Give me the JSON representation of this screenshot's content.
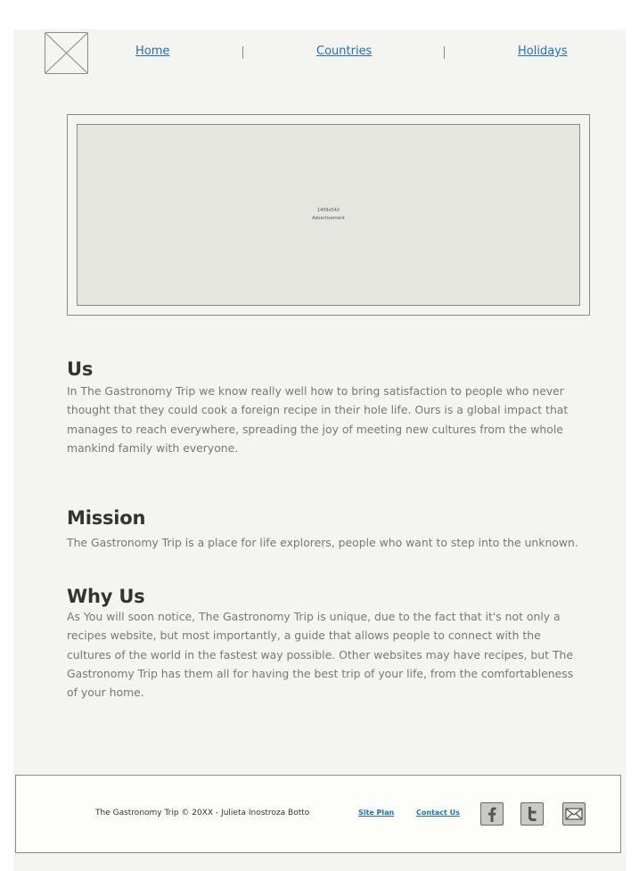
{
  "header": {
    "logo_icon": "image-placeholder-icon",
    "nav": [
      {
        "label": "Home"
      },
      {
        "label": "Countries"
      },
      {
        "label": "Holidays"
      }
    ]
  },
  "ad": {
    "size": "1409x542",
    "label": "Advertisement"
  },
  "sections": [
    {
      "title": "Us",
      "text": "In The Gastronomy Trip we know really well how to bring satisfaction to people who never thought that they could cook a foreign recipe in their hole life. Ours is a global impact that manages to reach everywhere, spreading the joy of meeting new cultures from the whole mankind family with everyone."
    },
    {
      "title": "Mission",
      "text": "The Gastronomy Trip is a place for life explorers, people who want to step into the unknown."
    },
    {
      "title": "Why Us",
      "text": "As You will soon notice, The Gastronomy Trip is unique, due to the fact that it's not only a recipes website, but most importantly, a guide that allows people to connect with the cultures of the world in the fastest way possible. Other websites may have recipes, but The Gastronomy Trip has them all for having the best trip of your life, from the comfortableness of your home."
    }
  ],
  "footer": {
    "copyright": "The Gastronomy Trip © 20XX - Julieta Inostroza Botto",
    "links": [
      {
        "label": "Site Plan"
      },
      {
        "label": "Contact Us"
      }
    ],
    "social": [
      {
        "icon": "facebook-icon"
      },
      {
        "icon": "twitter-icon"
      },
      {
        "icon": "email-icon"
      }
    ]
  }
}
